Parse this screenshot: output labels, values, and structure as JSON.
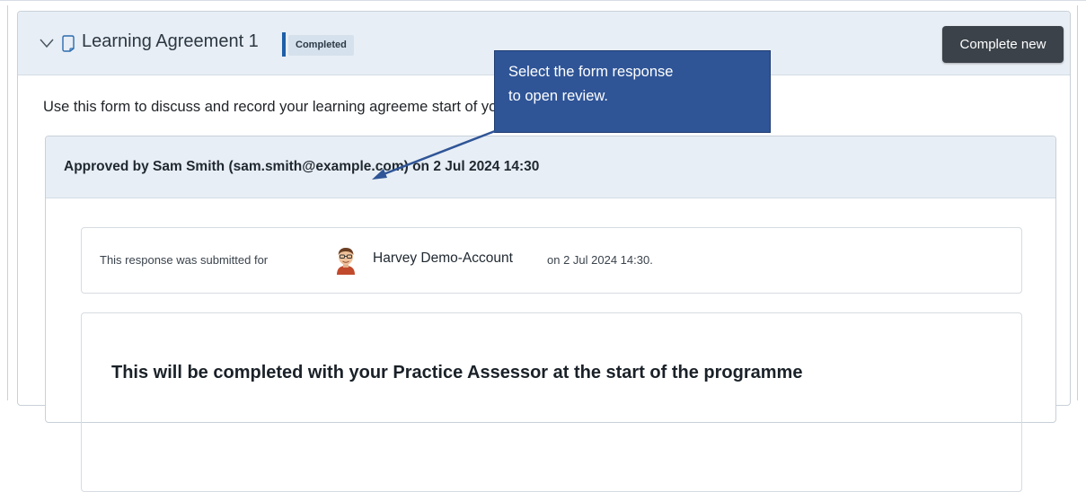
{
  "section": {
    "title": "Learning Agreement 1",
    "status_badge": "Completed",
    "complete_new_label": "Complete new",
    "description": "Use this form to discuss and record your learning agreeme                                                    start of your programme."
  },
  "approval": {
    "title": "Approved by Sam Smith (sam.smith@example.com) on 2 Jul 2024 14:30"
  },
  "submission": {
    "prefix": "This response was submitted for",
    "name": "Harvey Demo-Account",
    "date_suffix": "on 2 Jul 2024 14:30."
  },
  "form": {
    "heading": "This will be completed with your Practice Assessor at the start of the programme"
  },
  "callout": {
    "line1": "Select the form response",
    "line2": "to open review."
  },
  "colors": {
    "header_bg": "#e8eef5",
    "accent": "#1e5fa8",
    "button_bg": "#3b4249",
    "callout_bg": "#2f5597"
  }
}
